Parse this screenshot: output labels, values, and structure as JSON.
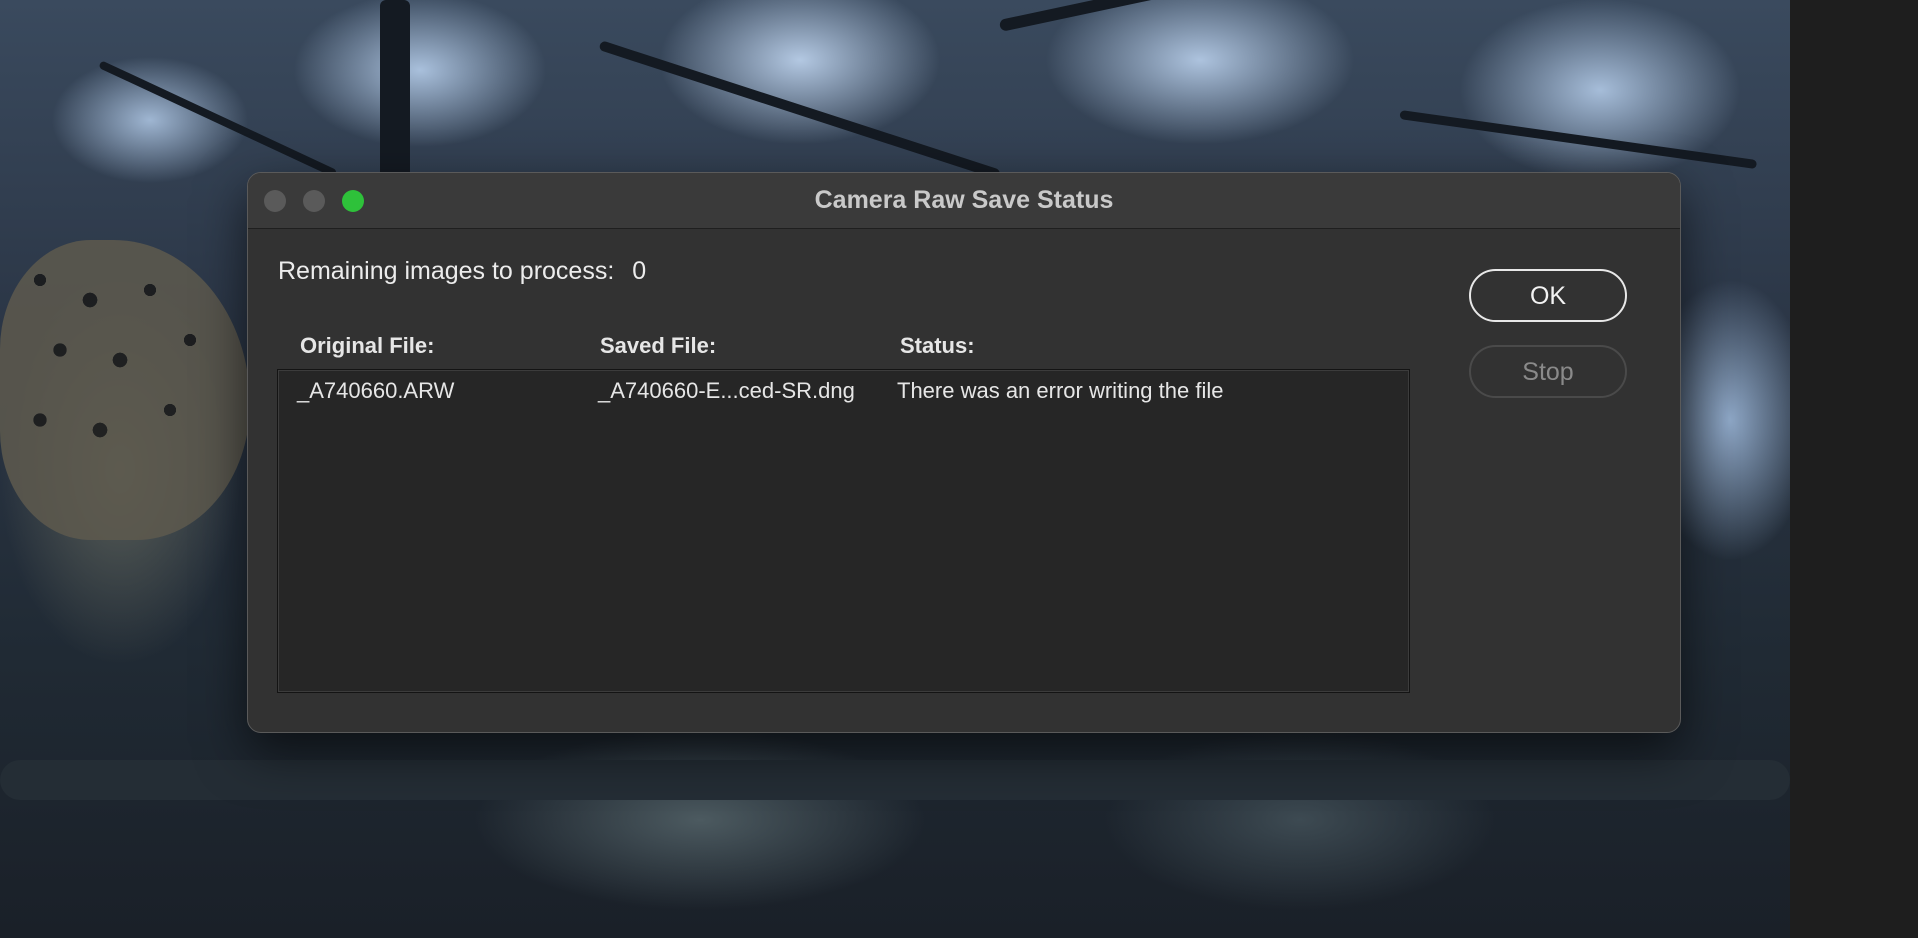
{
  "dialog": {
    "title": "Camera Raw Save Status",
    "remaining_label": "Remaining images to process:",
    "remaining_count": "0",
    "columns": {
      "original": "Original File:",
      "saved": "Saved File:",
      "status": "Status:"
    },
    "rows": [
      {
        "original": "_A740660.ARW",
        "saved": "_A740660-E...ced-SR.dng",
        "status": "There was an error writing the file"
      }
    ],
    "buttons": {
      "ok": "OK",
      "stop": "Stop"
    }
  },
  "window_controls": {
    "close": "close-icon",
    "minimize": "minimize-icon",
    "zoom": "zoom-icon",
    "zoom_color": "#2ec13a"
  }
}
